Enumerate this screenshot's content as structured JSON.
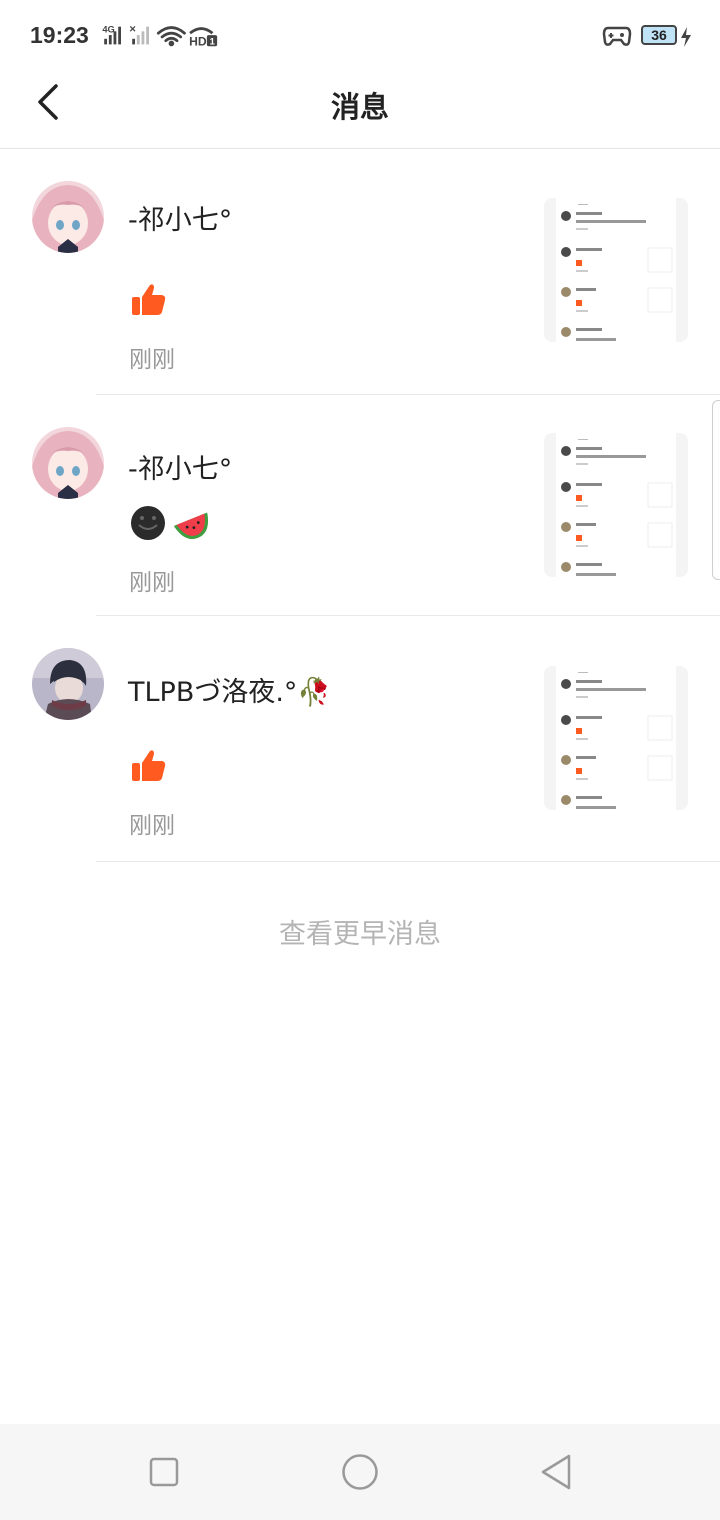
{
  "status_bar": {
    "time": "19:23",
    "network": "4G",
    "hd_label": "HD",
    "battery": "36",
    "icons": [
      "signal-icon",
      "signal-off-icon",
      "wifi-icon",
      "hd-call-icon",
      "gamepad-icon",
      "battery-icon",
      "charging-icon"
    ]
  },
  "header": {
    "title": "消息",
    "back_icon": "back-arrow-icon"
  },
  "messages": [
    {
      "user": "-祁小七°",
      "reaction": [
        "like-icon"
      ],
      "time": "刚刚",
      "avatar": "anime-girl-pink"
    },
    {
      "user": "-祁小七°",
      "reaction": [
        "dark-smile-emoji",
        "watermelon-emoji"
      ],
      "time": "刚刚",
      "avatar": "anime-girl-pink"
    },
    {
      "user": "TLPBづ洛夜.°🥀",
      "reaction": [
        "like-icon"
      ],
      "time": "刚刚",
      "avatar": "anime-boy-scarf"
    }
  ],
  "more_label": "查看更早消息",
  "nav_bar": {
    "icons": [
      "recent-apps-icon",
      "home-icon",
      "back-icon"
    ]
  },
  "colors": {
    "accent_like": "#ff5a1f",
    "time_text": "#999999",
    "more_text": "#b4b4b4"
  }
}
